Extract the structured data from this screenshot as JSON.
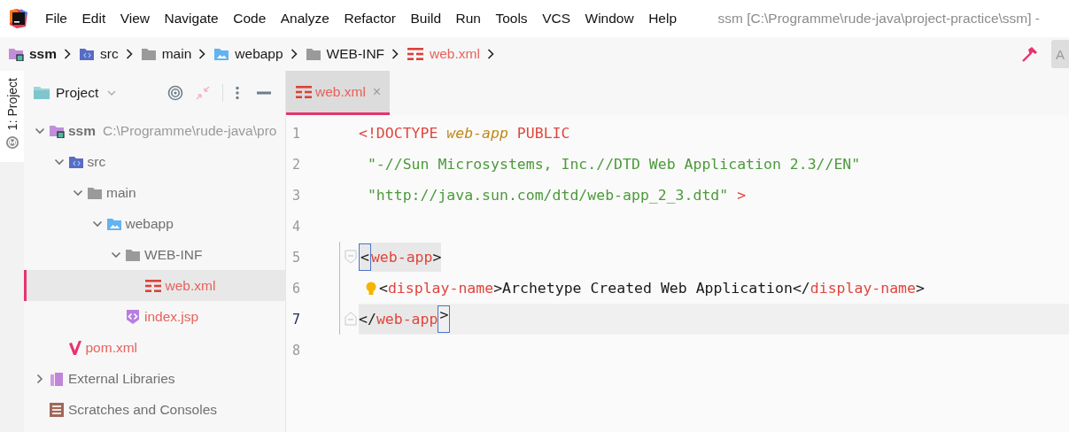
{
  "menu": {
    "items": [
      {
        "label": "File"
      },
      {
        "label": "Edit"
      },
      {
        "label": "View"
      },
      {
        "label": "Navigate"
      },
      {
        "label": "Code"
      },
      {
        "label": "Analyze"
      },
      {
        "label": "Refactor"
      },
      {
        "label": "Build"
      },
      {
        "label": "Run"
      },
      {
        "label": "Tools"
      },
      {
        "label": "VCS"
      },
      {
        "label": "Window"
      },
      {
        "label": "Help"
      }
    ]
  },
  "window": {
    "title": "ssm [C:\\Programme\\rude-java\\project-practice\\ssm] -"
  },
  "breadcrumbs": [
    {
      "label": "ssm",
      "kind": "module",
      "bold": true,
      "color": "#1a1a1a"
    },
    {
      "label": "src",
      "kind": "source",
      "bold": false,
      "color": "#1a1a1a"
    },
    {
      "label": "main",
      "kind": "folder",
      "bold": false,
      "color": "#1a1a1a"
    },
    {
      "label": "webapp",
      "kind": "web",
      "bold": false,
      "color": "#1a1a1a"
    },
    {
      "label": "WEB-INF",
      "kind": "folder",
      "bold": false,
      "color": "#1a1a1a"
    },
    {
      "label": "web.xml",
      "kind": "xml",
      "bold": false,
      "color": "#e8625b"
    }
  ],
  "toolbar": {
    "button": "A"
  },
  "tool_stripe": {
    "label": "1: Project"
  },
  "project_panel": {
    "title": "Project",
    "tree": [
      {
        "label": "ssm",
        "path": "C:\\Programme\\rude-java\\pro",
        "kind": "module",
        "expanded": true,
        "selected": false,
        "color": "#707070",
        "children": [
          {
            "label": "src",
            "kind": "source",
            "expanded": true,
            "selected": false,
            "color": "#707070",
            "children": [
              {
                "label": "main",
                "kind": "folder",
                "expanded": true,
                "selected": false,
                "color": "#707070",
                "children": [
                  {
                    "label": "webapp",
                    "kind": "web",
                    "expanded": true,
                    "selected": false,
                    "color": "#707070",
                    "children": [
                      {
                        "label": "WEB-INF",
                        "kind": "folder",
                        "expanded": true,
                        "selected": false,
                        "color": "#707070",
                        "children": [
                          {
                            "label": "web.xml",
                            "kind": "xml",
                            "selected": true,
                            "color": "#e8625b"
                          }
                        ]
                      },
                      {
                        "label": "index.jsp",
                        "kind": "jsp",
                        "selected": false,
                        "color": "#e8625b"
                      }
                    ]
                  }
                ]
              }
            ]
          },
          {
            "label": "pom.xml",
            "kind": "maven",
            "selected": false,
            "color": "#e8625b"
          }
        ]
      },
      {
        "label": "External Libraries",
        "kind": "library",
        "expanded": false,
        "selected": false,
        "color": "#707070"
      },
      {
        "label": "Scratches and Consoles",
        "kind": "scratch",
        "selected": false,
        "color": "#707070"
      }
    ]
  },
  "editor": {
    "tabs": [
      {
        "label": "web.xml",
        "kind": "xml",
        "selected": true,
        "close": "×"
      }
    ],
    "lines": [
      {
        "number": "1",
        "current": false,
        "fold_start": false,
        "fold_end": false,
        "bulb": false,
        "tokens": [
          {
            "text": "<!DOCTYPE ",
            "kind": "tag"
          },
          {
            "text": "web-app",
            "kind": "italic"
          },
          {
            "text": " PUBLIC",
            "kind": "tag"
          }
        ]
      },
      {
        "number": "2",
        "current": false,
        "fold_start": false,
        "fold_end": false,
        "bulb": false,
        "tokens": [
          {
            "text": " \"-//Sun Microsystems, Inc.//DTD Web Application 2.3//EN\"",
            "kind": "string"
          }
        ]
      },
      {
        "number": "3",
        "current": false,
        "fold_start": false,
        "fold_end": false,
        "bulb": false,
        "tokens": [
          {
            "text": " \"http://java.sun.com/dtd/web-app_2_3.dtd\"",
            "kind": "string"
          },
          {
            "text": " >",
            "kind": "tag"
          }
        ]
      },
      {
        "number": "4",
        "current": false,
        "fold_start": false,
        "fold_end": false,
        "bulb": false
      },
      {
        "number": "5",
        "current": false,
        "fold_start": true,
        "fold_end": false,
        "bulb": false,
        "tokens": [
          {
            "text": "<",
            "kind": "text",
            "matched": true,
            "highlighted": true
          },
          {
            "text": "web-app",
            "kind": "tag",
            "highlighted": true
          },
          {
            "text": ">",
            "kind": "text",
            "highlighted": true
          }
        ]
      },
      {
        "number": "6",
        "current": false,
        "fold_start": false,
        "fold_end": false,
        "bulb": true,
        "tokens": [
          {
            "text": "<",
            "kind": "text"
          },
          {
            "text": "display-name",
            "kind": "tag"
          },
          {
            "text": ">Archetype Created Web Application</",
            "kind": "text"
          },
          {
            "text": "display-name",
            "kind": "tag"
          },
          {
            "text": ">",
            "kind": "text"
          }
        ]
      },
      {
        "number": "7",
        "current": true,
        "fold_start": false,
        "fold_end": true,
        "bulb": false,
        "tokens": [
          {
            "text": "</",
            "kind": "text",
            "highlighted": true
          },
          {
            "text": "web-app",
            "kind": "tag",
            "highlighted": true
          },
          {
            "text": ">",
            "kind": "text",
            "matched": true
          }
        ]
      },
      {
        "number": "8",
        "current": false,
        "fold_start": false,
        "fold_end": false,
        "bulb": false
      }
    ]
  }
}
